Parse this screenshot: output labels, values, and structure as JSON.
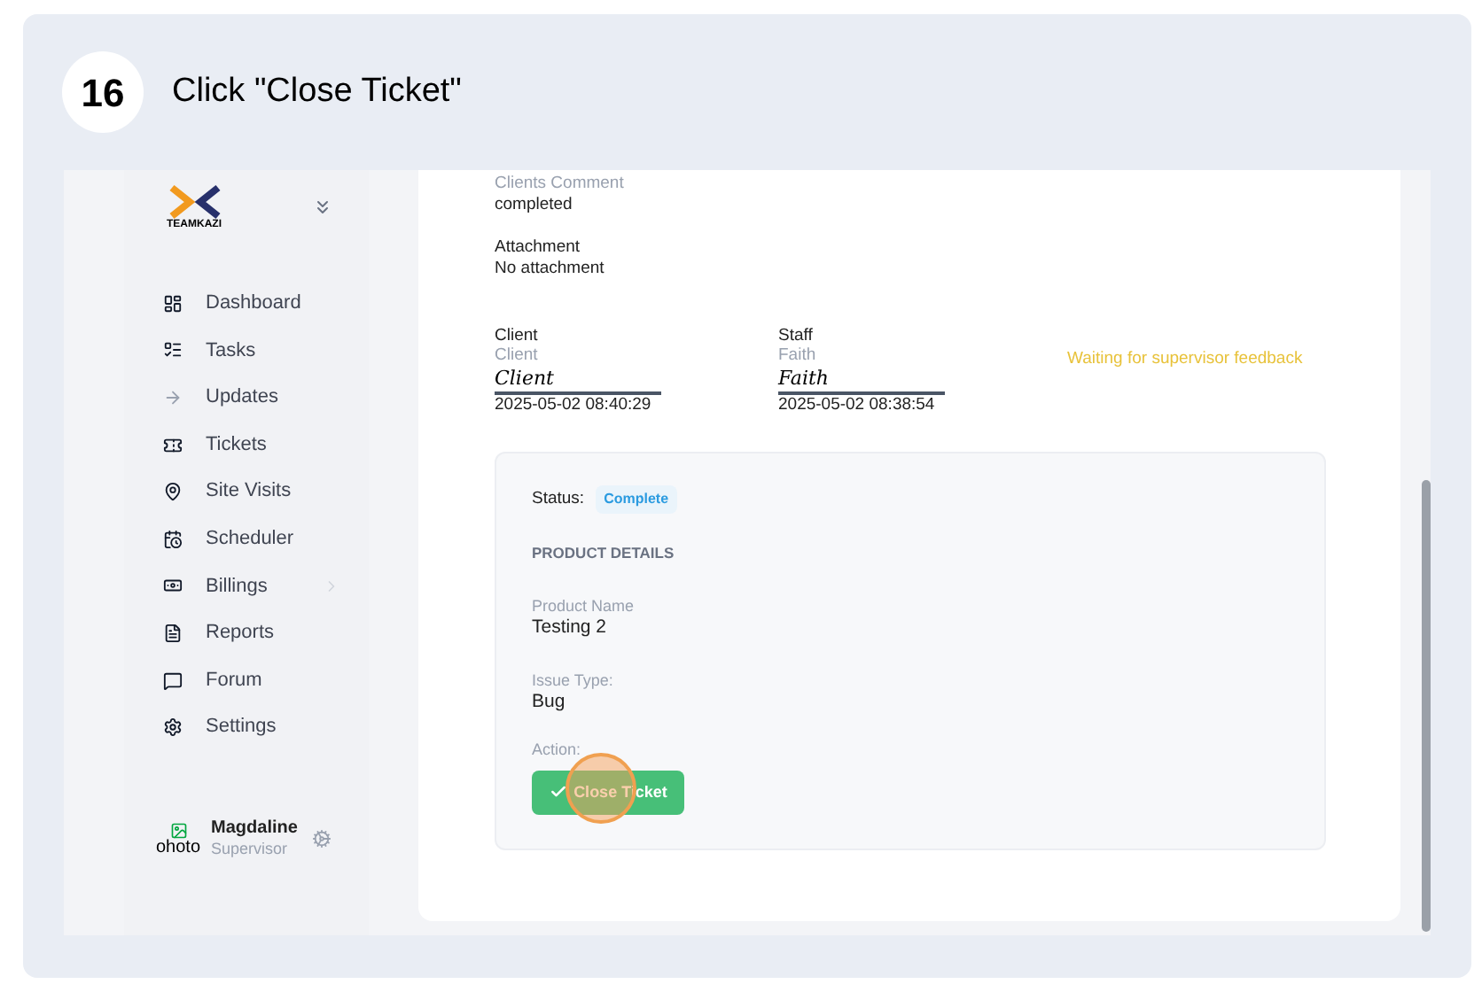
{
  "step": {
    "number": "16",
    "title": "Click \"Close Ticket\""
  },
  "sidebar": {
    "logo_text": "TEAMKAZI",
    "items": [
      {
        "label": "Dashboard",
        "has_submenu": false
      },
      {
        "label": "Tasks",
        "has_submenu": false
      },
      {
        "label": "Updates",
        "has_submenu": false
      },
      {
        "label": "Tickets",
        "has_submenu": false
      },
      {
        "label": "Site Visits",
        "has_submenu": false
      },
      {
        "label": "Scheduler",
        "has_submenu": false
      },
      {
        "label": "Billings",
        "has_submenu": true
      },
      {
        "label": "Reports",
        "has_submenu": false
      },
      {
        "label": "Forum",
        "has_submenu": false
      },
      {
        "label": "Settings",
        "has_submenu": false
      }
    ],
    "user": {
      "avatar_alt": "ohoto",
      "name": "Magdaline",
      "role": "Supervisor"
    }
  },
  "details": [
    {
      "label": "Clients Comment",
      "value": "completed"
    },
    {
      "label": "Attachment",
      "value": "No attachment"
    }
  ],
  "signatures": [
    {
      "heading": "Client",
      "name": "Client",
      "signature": "Client",
      "time": "2025-05-02 08:40:29"
    },
    {
      "heading": "Staff",
      "name": "Faith",
      "signature": "Faith",
      "time": "2025-05-02 08:38:54"
    }
  ],
  "feedback_note": "Waiting for supervisor feedback",
  "ticket": {
    "status_label": "Status:",
    "status": "Complete",
    "section": "PRODUCT DETAILS",
    "fields": [
      {
        "label": "Product Name",
        "value": "Testing 2"
      },
      {
        "label": "Issue Type:",
        "value": "Bug"
      }
    ],
    "action_label": "Action:",
    "button": "Close Ticket"
  }
}
